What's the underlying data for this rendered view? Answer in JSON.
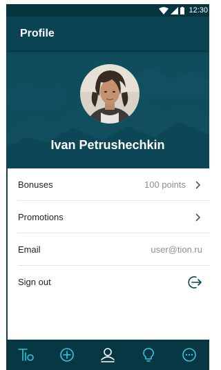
{
  "status_bar": {
    "time": "12:30"
  },
  "app_bar": {
    "title": "Profile"
  },
  "profile": {
    "name": "Ivan Petrushechkin"
  },
  "menu": {
    "bonuses": {
      "label": "Bonuses",
      "value": "100 points"
    },
    "promotions": {
      "label": "Promotions"
    },
    "email": {
      "label": "Email",
      "value": "user@tion.ru"
    },
    "sign_out": {
      "label": "Sign out"
    }
  },
  "bottom_nav": {
    "items": [
      {
        "icon": "tio-logo-icon",
        "active": false
      },
      {
        "icon": "add-circle-icon",
        "active": false
      },
      {
        "icon": "profile-icon",
        "active": true
      },
      {
        "icon": "lightbulb-icon",
        "active": false
      },
      {
        "icon": "chat-icon",
        "active": false
      }
    ]
  },
  "colors": {
    "status_bar": "#06343f",
    "app_bar": "#0a4452",
    "header_bg": "#0f4d5c",
    "bottom_nav": "#063742",
    "accent": "#2fc8e0",
    "sign_out_icon": "#0a4452"
  }
}
